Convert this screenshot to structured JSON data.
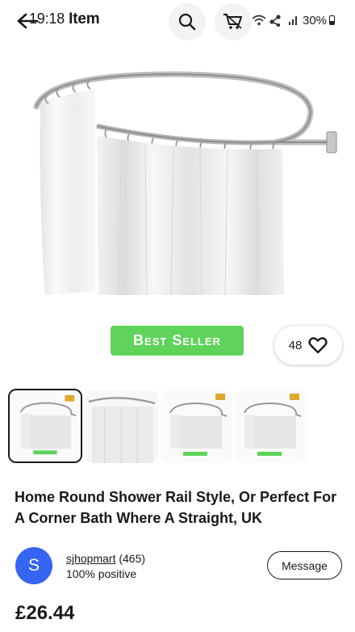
{
  "status_bar": {
    "time": "19:18",
    "battery": "30%"
  },
  "header": {
    "title": "Item"
  },
  "hero": {
    "badge": "Best Seller",
    "watch_count": "48"
  },
  "thumbnails": [
    {
      "selected": true
    },
    {
      "selected": false
    },
    {
      "selected": false
    },
    {
      "selected": false
    }
  ],
  "product": {
    "title": "Home Round Shower Rail Style, Or Perfect For A Corner Bath Where A Straight, UK",
    "price": "£26.44"
  },
  "seller": {
    "initial": "S",
    "name": "sjhopmart",
    "feedback_count": "(465)",
    "positive": "100% positive",
    "message_label": "Message"
  },
  "colors": {
    "badge_green": "#5fd35a",
    "avatar_blue": "#3665f3"
  }
}
